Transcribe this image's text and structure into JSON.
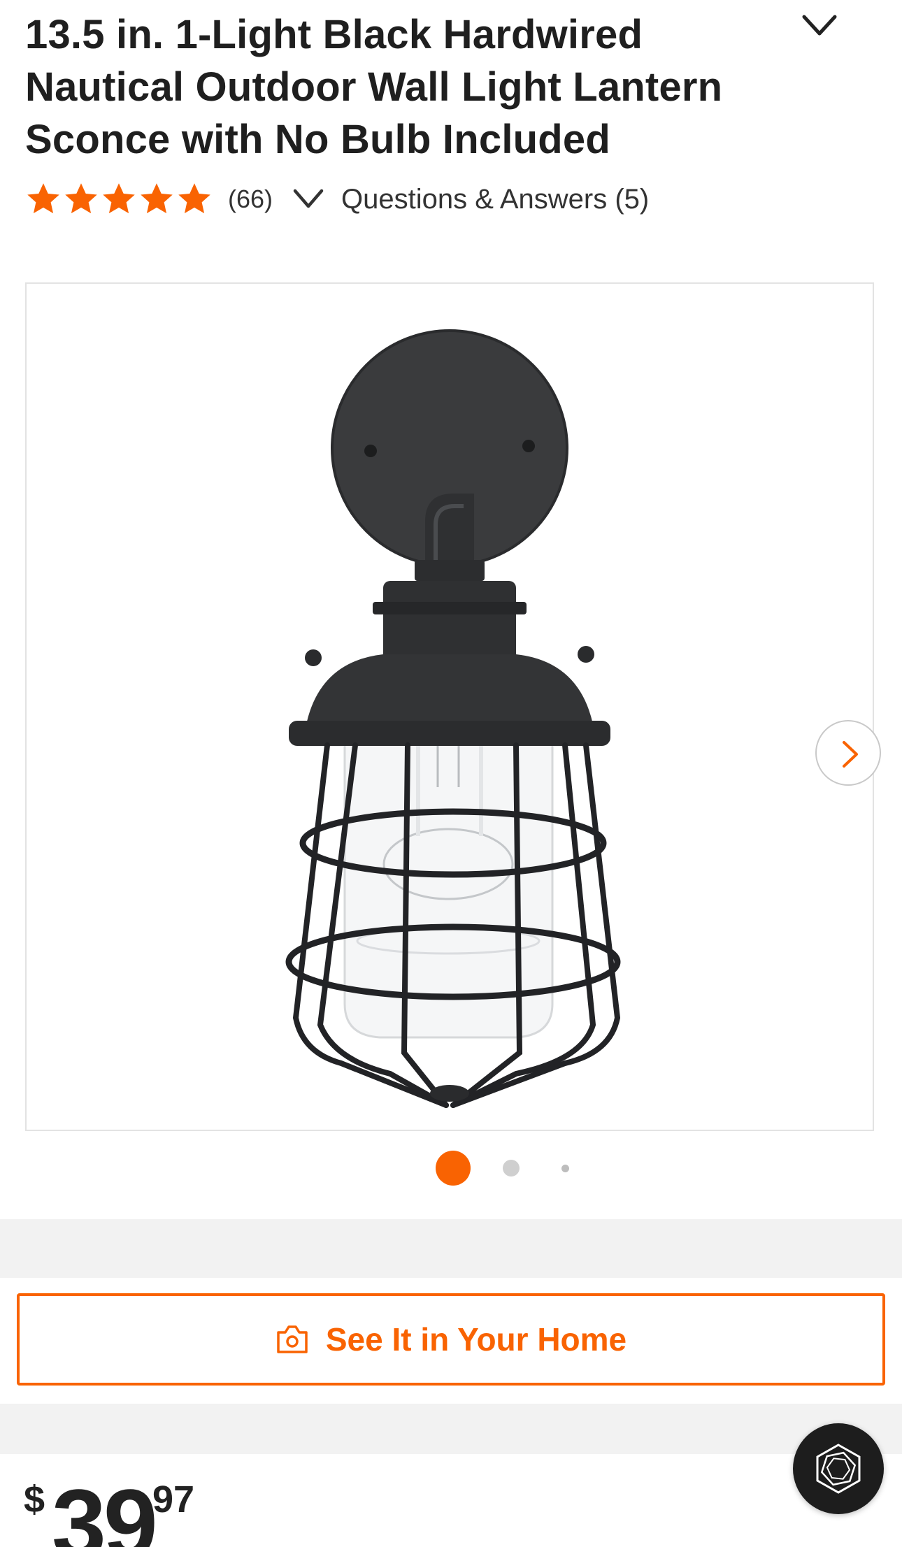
{
  "product": {
    "title": "13.5 in. 1-Light Black Hardwired Nautical Outdoor Wall Light Lantern Sconce with No Bulb Included",
    "rating": 5,
    "rating_max": 5,
    "review_count": "(66)",
    "qa_link": "Questions & Answers (5)"
  },
  "gallery": {
    "image_count": 3,
    "active_index": 1
  },
  "ar": {
    "button_label": "See It in Your Home",
    "icon": "camera-icon"
  },
  "price": {
    "currency": "$",
    "dollars": "39",
    "cents": "97"
  },
  "icons": {
    "title_toggle": "chevron-down-icon",
    "qa_toggle": "chevron-down-icon",
    "next": "chevron-right-icon",
    "chat": "assistant-hexagon-icon"
  },
  "colors": {
    "accent": "#f96302",
    "star": "#f96302",
    "text": "#1f1f1f",
    "band": "#f2f2f2"
  }
}
